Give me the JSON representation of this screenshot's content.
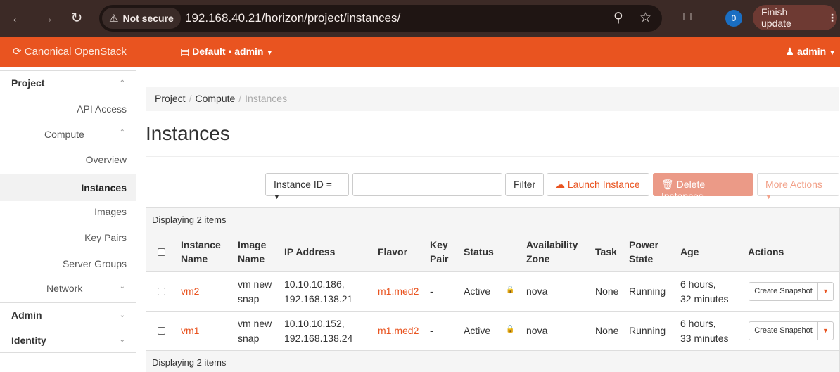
{
  "browser": {
    "security_label": "Not secure",
    "url": "192.168.40.21/horizon/project/instances/",
    "profile_initial": "0",
    "update_label": "Finish update"
  },
  "header": {
    "brand": "Canonical OpenStack",
    "project_switcher": "Default • admin",
    "user": "admin",
    "accent_color": "#e95420"
  },
  "sidebar": {
    "project": "Project",
    "api_access": "API Access",
    "compute": "Compute",
    "overview": "Overview",
    "instances": "Instances",
    "images": "Images",
    "key_pairs": "Key Pairs",
    "server_groups": "Server Groups",
    "network": "Network",
    "admin": "Admin",
    "identity": "Identity"
  },
  "breadcrumb": {
    "project": "Project",
    "compute": "Compute",
    "current": "Instances"
  },
  "page": {
    "title": "Instances"
  },
  "toolbar": {
    "filter_field": "Instance ID =",
    "filter_value": "",
    "filter_button": "Filter",
    "launch_button": "Launch Instance",
    "delete_button": "Delete Instances",
    "more_button": "More Actions"
  },
  "table": {
    "caption_top": "Displaying 2 items",
    "caption_bottom": "Displaying 2 items",
    "columns": {
      "instance_name_1": "Instance",
      "instance_name_2": "Name",
      "image_name_1": "Image",
      "image_name_2": "Name",
      "ip_address": "IP Address",
      "flavor": "Flavor",
      "key_pair_1": "Key",
      "key_pair_2": "Pair",
      "status": "Status",
      "az_1": "Availability",
      "az_2": "Zone",
      "task": "Task",
      "power_1": "Power",
      "power_2": "State",
      "age": "Age",
      "actions": "Actions"
    },
    "rows": [
      {
        "name": "vm2",
        "image_1": "vm new",
        "image_2": "snap",
        "ip_1": "10.10.10.186,",
        "ip_2": "192.168.138.21",
        "flavor": "m1.med2",
        "key_pair": "-",
        "status": "Active",
        "az": "nova",
        "task": "None",
        "power": "Running",
        "age_1": "6 hours,",
        "age_2": "32 minutes",
        "action": "Create Snapshot"
      },
      {
        "name": "vm1",
        "image_1": "vm new",
        "image_2": "snap",
        "ip_1": "10.10.10.152,",
        "ip_2": "192.168.138.24",
        "flavor": "m1.med2",
        "key_pair": "-",
        "status": "Active",
        "az": "nova",
        "task": "None",
        "power": "Running",
        "age_1": "6 hours,",
        "age_2": "33 minutes",
        "action": "Create Snapshot"
      }
    ]
  }
}
